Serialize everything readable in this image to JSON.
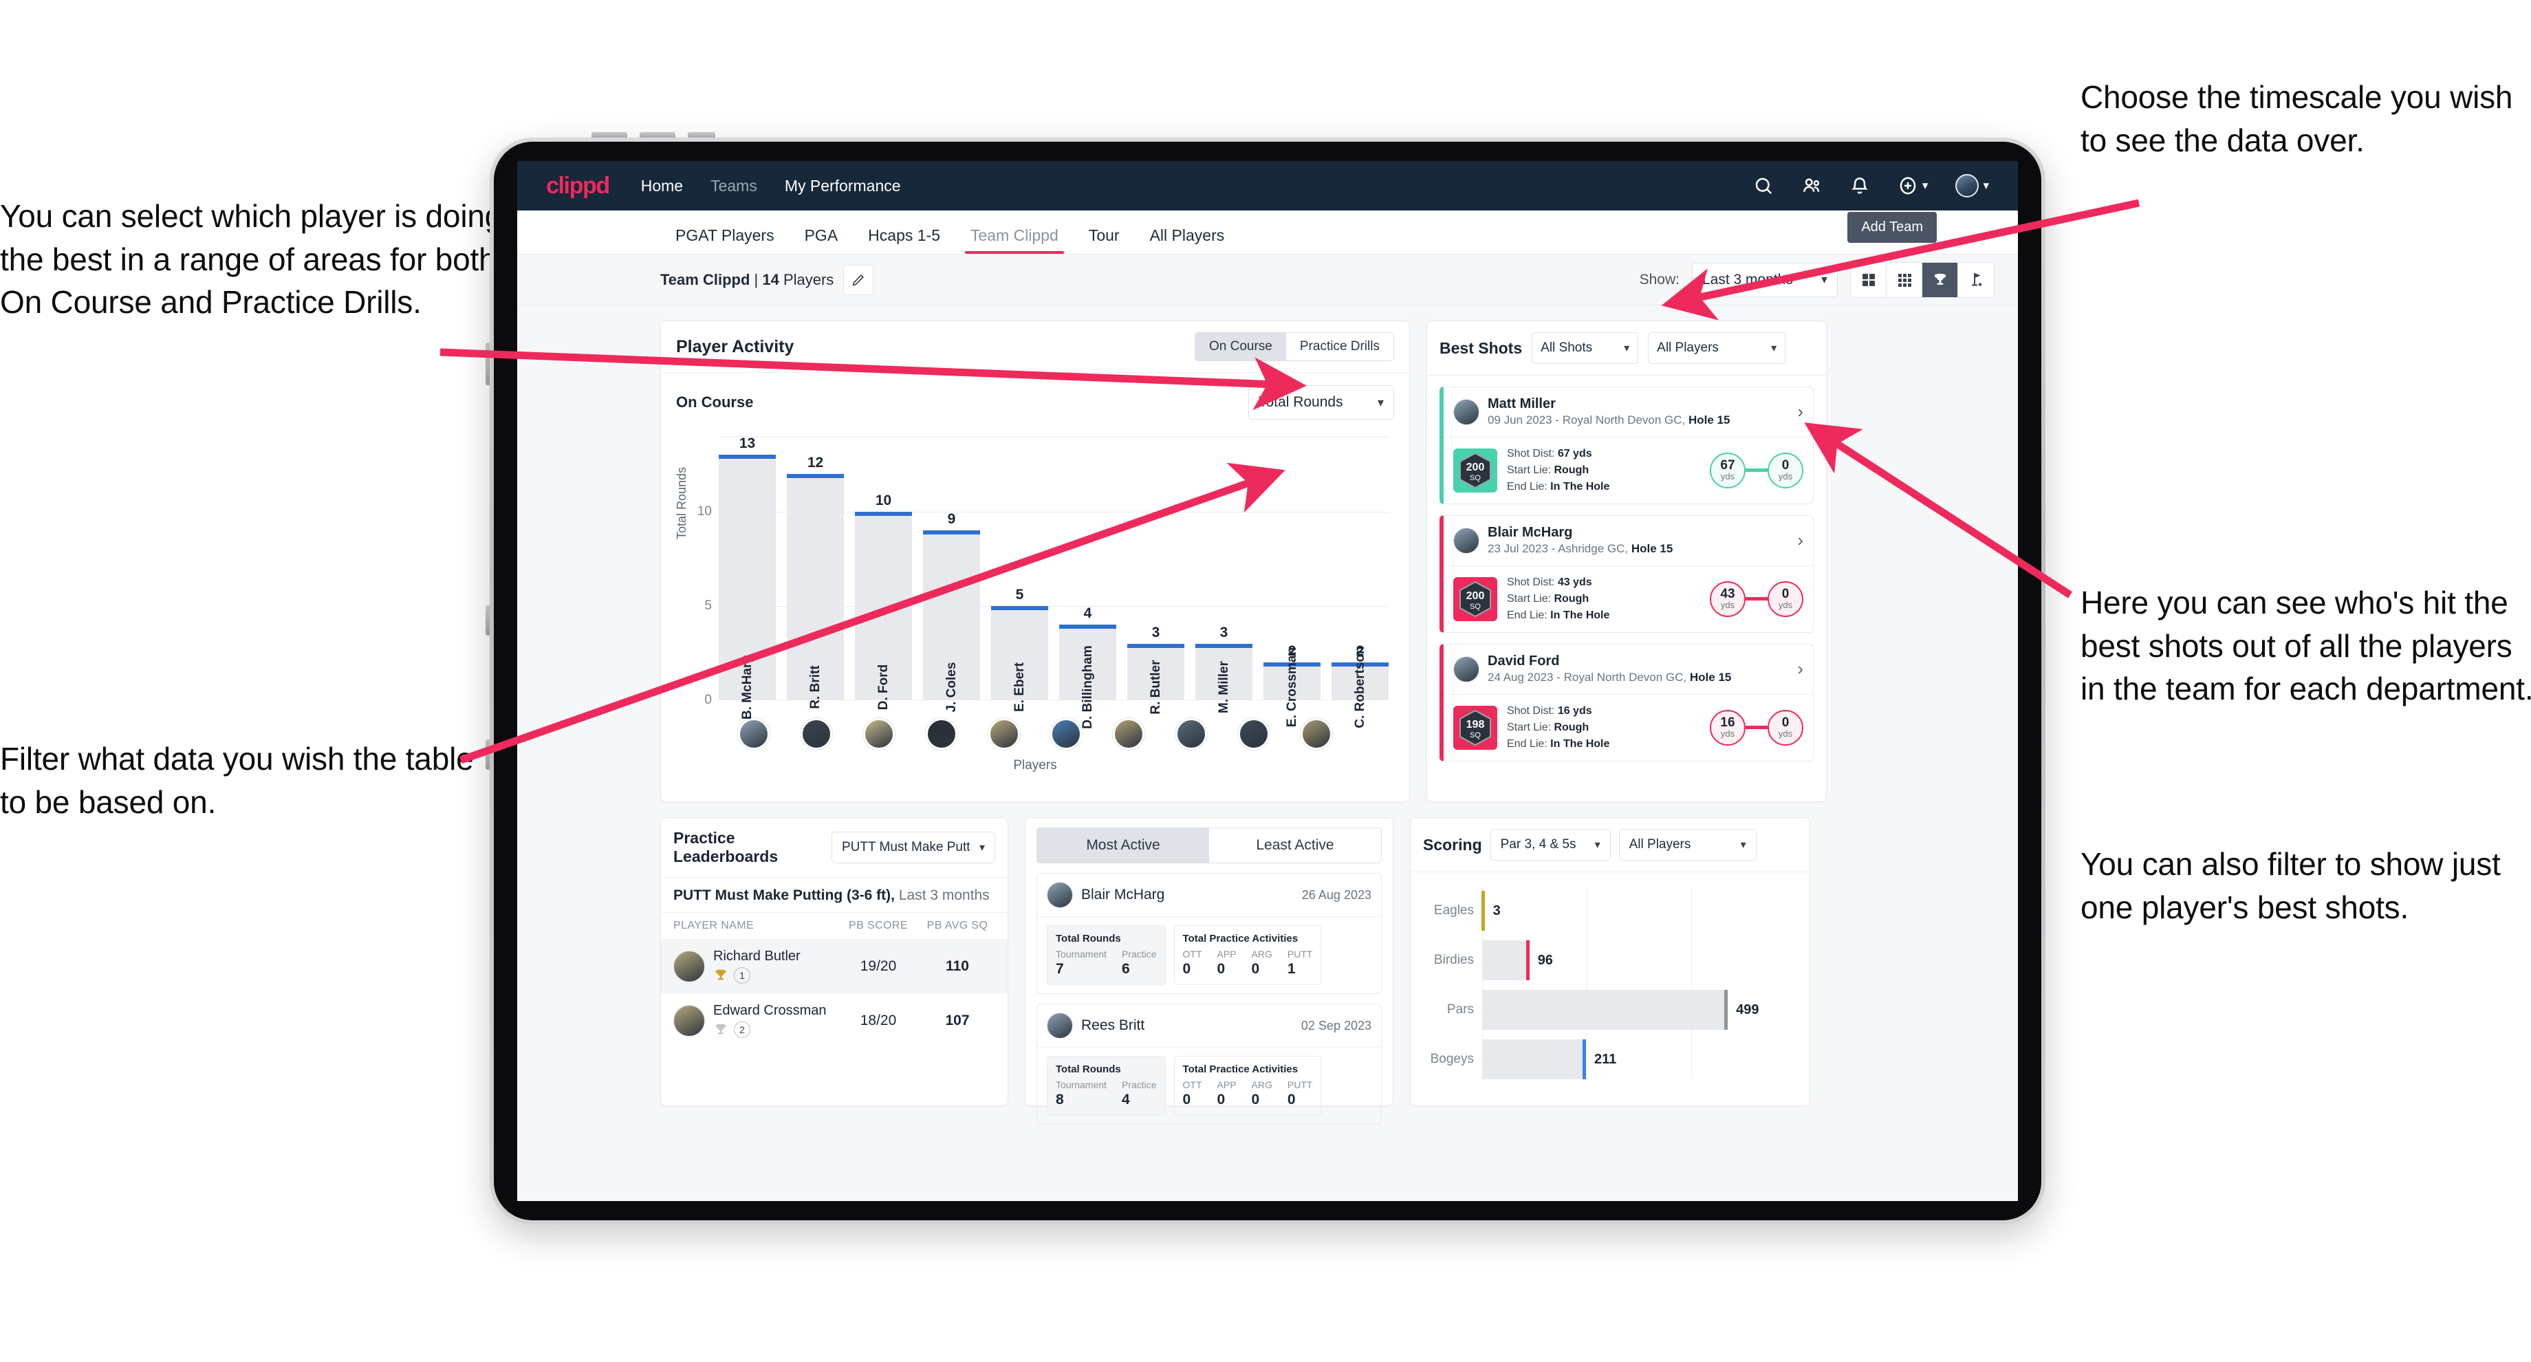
{
  "annotations": {
    "left_top": "You can select which player is doing the best in a range of areas for both On Course and Practice Drills.",
    "left_bottom": "Filter what data you wish the table to be based on.",
    "right_top": "Choose the timescale you wish to see the data over.",
    "right_mid": "Here you can see who's hit the best shots out of all the players in the team for each department.",
    "right_bottom": "You can also filter to show just one player's best shots."
  },
  "topbar": {
    "logo": "clippd",
    "links": [
      "Home",
      "Teams",
      "My Performance"
    ],
    "icons": [
      "search-icon",
      "people-icon",
      "bell-icon",
      "plus-circle-icon",
      "avatar-icon"
    ]
  },
  "tabs": [
    {
      "label": "PGAT Players",
      "active": false
    },
    {
      "label": "PGA",
      "active": false
    },
    {
      "label": "Hcaps 1-5",
      "active": false
    },
    {
      "label": "Team Clippd",
      "active": true
    },
    {
      "label": "Tour",
      "active": false
    },
    {
      "label": "All Players",
      "active": false
    }
  ],
  "subheader": {
    "team_name": "Team Clippd",
    "team_separator": " | ",
    "player_count": "14",
    "players_word": " Players",
    "show_label": "Show:",
    "timescale_value": "Last 3 months",
    "tooltip": "Add Team",
    "view_buttons": [
      "grid-4-icon",
      "grid-9-icon",
      "trophy-icon",
      "golf-flag-icon"
    ],
    "active_view": 2
  },
  "player_activity": {
    "title": "Player Activity",
    "toggle": [
      "On Course",
      "Practice Drills"
    ],
    "toggle_active": 0,
    "sub_title": "On Course",
    "metric_select": "Total Rounds"
  },
  "chart_data": [
    {
      "type": "bar",
      "title": "Player Activity - On Course",
      "categories": [
        "B. McHarg",
        "R. Britt",
        "D. Ford",
        "J. Coles",
        "E. Ebert",
        "D. Billingham",
        "R. Butler",
        "M. Miller",
        "E. Crossman",
        "C. Robertson"
      ],
      "values": [
        13,
        12,
        10,
        9,
        5,
        4,
        3,
        3,
        2,
        2
      ],
      "xlabel": "Players",
      "ylabel": "Total Rounds",
      "yticks": [
        0,
        5,
        10
      ],
      "ylim": [
        0,
        14
      ],
      "grid": true,
      "bar_color": "#e7e9ed",
      "bar_cap_color": "#2f6fd0"
    },
    {
      "type": "bar",
      "orientation": "horizontal",
      "title": "Scoring",
      "categories": [
        "Eagles",
        "Birdies",
        "Pars",
        "Bogeys"
      ],
      "values": [
        3,
        96,
        499,
        211
      ],
      "xlabel": "",
      "ylabel": "",
      "xlim": [
        0,
        640
      ],
      "grid": true,
      "colors": [
        "#c9a227",
        "#ee2a5c",
        "#8d949c",
        "#3b82e8"
      ]
    }
  ],
  "best_shots": {
    "title": "Best Shots",
    "shots_filter": "All Shots",
    "players_filter": "All Players",
    "cards": [
      {
        "player": "Matt Miller",
        "meta_date": "09 Jun 2023",
        "meta_course": " - Royal North Devon GC, ",
        "meta_hole": "Hole 15",
        "badge_num": "200",
        "badge_unit": "SQ",
        "shot_dist_label": "Shot Dist: ",
        "shot_dist": "67 yds",
        "start_lie_label": "Start Lie: ",
        "start_lie": "Rough",
        "end_lie_label": "End Lie: ",
        "end_lie": "In The Hole",
        "from_val": "67",
        "from_unit": "yds",
        "to_val": "0",
        "to_unit": "yds",
        "accent": "teal"
      },
      {
        "player": "Blair McHarg",
        "meta_date": "23 Jul 2023",
        "meta_course": " - Ashridge GC, ",
        "meta_hole": "Hole 15",
        "badge_num": "200",
        "badge_unit": "SQ",
        "shot_dist_label": "Shot Dist: ",
        "shot_dist": "43 yds",
        "start_lie_label": "Start Lie: ",
        "start_lie": "Rough",
        "end_lie_label": "End Lie: ",
        "end_lie": "In The Hole",
        "from_val": "43",
        "from_unit": "yds",
        "to_val": "0",
        "to_unit": "yds",
        "accent": "pink"
      },
      {
        "player": "David Ford",
        "meta_date": "24 Aug 2023",
        "meta_course": " - Royal North Devon GC, ",
        "meta_hole": "Hole 15",
        "badge_num": "198",
        "badge_unit": "SQ",
        "shot_dist_label": "Shot Dist: ",
        "shot_dist": "16 yds",
        "start_lie_label": "Start Lie: ",
        "start_lie": "Rough",
        "end_lie_label": "End Lie: ",
        "end_lie": "In The Hole",
        "from_val": "16",
        "from_unit": "yds",
        "to_val": "0",
        "to_unit": "yds",
        "accent": "pink"
      }
    ]
  },
  "practice_leaderboards": {
    "title": "Practice Leaderboards",
    "drill_select": "PUTT Must Make Putting ...",
    "sub_bold": "PUTT Must Make Putting (3-6 ft),",
    "sub_light": " Last 3 months",
    "columns": [
      "PLAYER NAME",
      "PB SCORE",
      "PB AVG SQ"
    ],
    "rows": [
      {
        "name": "Richard Butler",
        "rank": "1",
        "pb_score": "19/20",
        "pb_avg_sq": "110",
        "trophy": "gold"
      },
      {
        "name": "Edward Crossman",
        "rank": "2",
        "pb_score": "18/20",
        "pb_avg_sq": "107",
        "trophy": "silver"
      }
    ]
  },
  "activity_panel": {
    "tabs": [
      "Most Active",
      "Least Active"
    ],
    "active_tab": 0,
    "cards": [
      {
        "name": "Blair McHarg",
        "date": "26 Aug 2023",
        "rounds_title": "Total Rounds",
        "rounds_keys": [
          "Tournament",
          "Practice"
        ],
        "rounds_vals": [
          "7",
          "6"
        ],
        "practice_title": "Total Practice Activities",
        "practice_keys": [
          "OTT",
          "APP",
          "ARG",
          "PUTT"
        ],
        "practice_vals": [
          "0",
          "0",
          "0",
          "1"
        ]
      },
      {
        "name": "Rees Britt",
        "date": "02 Sep 2023",
        "rounds_title": "Total Rounds",
        "rounds_keys": [
          "Tournament",
          "Practice"
        ],
        "rounds_vals": [
          "8",
          "4"
        ],
        "practice_title": "Total Practice Activities",
        "practice_keys": [
          "OTT",
          "APP",
          "ARG",
          "PUTT"
        ],
        "practice_vals": [
          "0",
          "0",
          "0",
          "0"
        ]
      }
    ]
  },
  "scoring_panel": {
    "title": "Scoring",
    "par_filter": "Par 3, 4 & 5s",
    "players_filter": "All Players"
  },
  "colors": {
    "brand_pink": "#ee2a5c",
    "navbar": "#17283a",
    "teal": "#47d1ad",
    "bar_blue": "#2f6fd0",
    "page_bg": "#f6f7f9"
  }
}
